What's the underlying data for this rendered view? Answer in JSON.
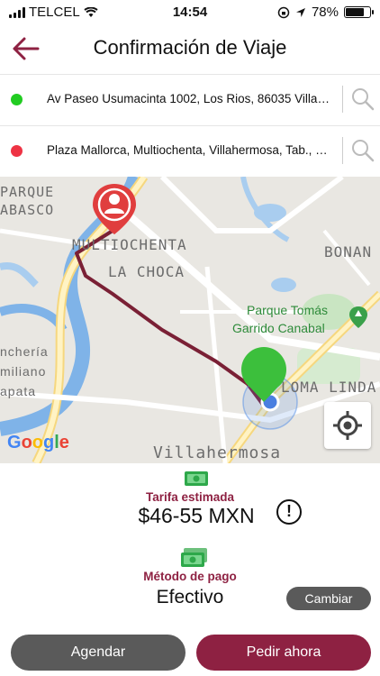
{
  "status_bar": {
    "carrier": "TELCEL",
    "time": "14:54",
    "battery": "78%",
    "battery_level": 0.78
  },
  "header": {
    "title": "Confirmación de Viaje",
    "back_icon": "back-arrow-icon"
  },
  "origin": {
    "address": "Av Paseo Usumacinta 1002, Los Rios, 86035 Villah…",
    "dot_color": "#22cc22"
  },
  "destination": {
    "address": "Plaza Mallorca, Multiochenta, Villahermosa, Tab., M…",
    "dot_color": "#ee3344"
  },
  "map": {
    "labels": {
      "parque_tabasco_1": "PARQUE",
      "parque_tabasco_2": "ABASCO",
      "multiochenta": "MULTIOCHENTA",
      "la_choca": "LA CHOCA",
      "bonan": "BONAN",
      "parque_tomas_1": "Parque Tomás",
      "parque_tomas_2": "Garrido Canabal",
      "loma_linda": "LOMA LINDA",
      "rancheria_1": "nchería",
      "rancheria_2": "miliano",
      "rancheria_3": "apata",
      "villahermosa": "Villahermosa"
    },
    "attribution": "Google",
    "route_color": "#7a2035"
  },
  "fare": {
    "label": "Tarifa estimada",
    "value": "$46-55 MXN"
  },
  "payment": {
    "label": "Método de pago",
    "value": "Efectivo",
    "change_label": "Cambiar"
  },
  "actions": {
    "schedule_label": "Agendar",
    "request_label": "Pedir ahora"
  },
  "colors": {
    "accent": "#8e2142",
    "dark_button": "#5a5a5a"
  }
}
